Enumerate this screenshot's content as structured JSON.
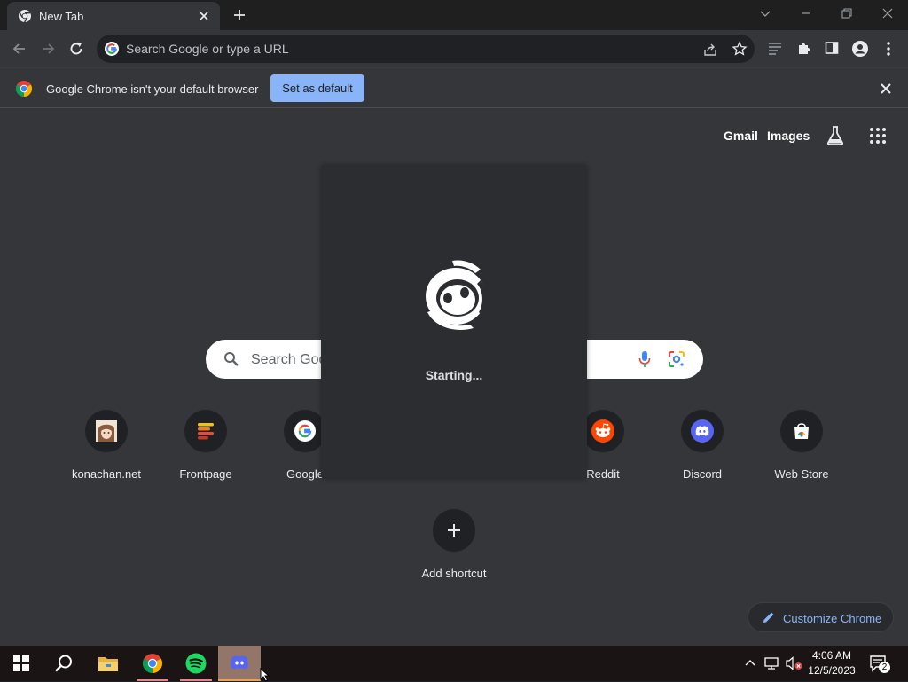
{
  "tab": {
    "title": "New Tab"
  },
  "omnibox": {
    "placeholder": "Search Google or type a URL"
  },
  "infobar": {
    "message": "Google Chrome isn't your default browser",
    "button_label": "Set as default"
  },
  "ntp": {
    "top_links": [
      "Gmail",
      "Images"
    ],
    "search_placeholder": "Search Goo",
    "shortcuts": [
      {
        "label": "konachan.net",
        "icon": "konachan-icon"
      },
      {
        "label": "Frontpage",
        "icon": "frontpage-icon"
      },
      {
        "label": "Google",
        "icon": "google-icon"
      },
      {
        "label": "Reddit",
        "icon": "reddit-icon"
      },
      {
        "label": "Discord",
        "icon": "discord-icon"
      },
      {
        "label": "Web Store",
        "icon": "web-store-icon"
      }
    ],
    "add_shortcut_label": "Add shortcut",
    "customize_label": "Customize Chrome"
  },
  "splash": {
    "status": "Starting..."
  },
  "taskbar": {
    "apps": [
      "start-icon",
      "search-icon",
      "file-explorer-icon",
      "chrome-icon",
      "spotify-icon",
      "discord-icon"
    ],
    "time": "4:06 AM",
    "date": "12/5/2023",
    "notification_count": "2"
  },
  "colors": {
    "accent": "#8ab4f8",
    "discord_blurple": "#5865f2",
    "ntp_background": "#35363a"
  }
}
